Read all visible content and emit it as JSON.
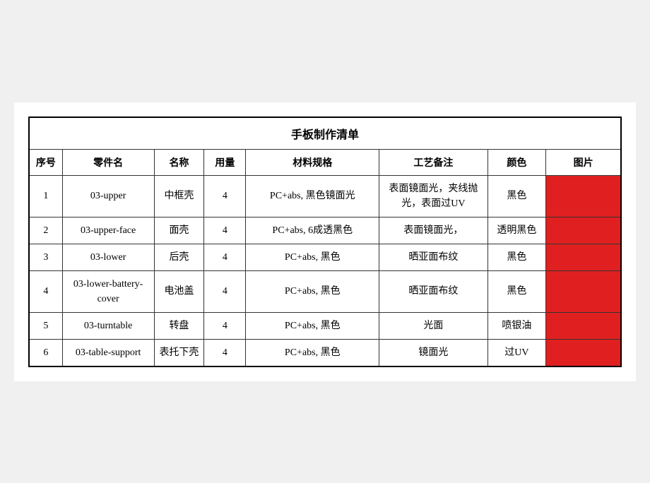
{
  "title": "手板制作清单",
  "headers": [
    "序号",
    "零件名",
    "名称",
    "用量",
    "材料规格",
    "工艺备注",
    "颜色",
    "图片"
  ],
  "rows": [
    {
      "seq": "1",
      "part": "03-upper",
      "name": "中框壳",
      "qty": "4",
      "spec": "PC+abs, 黑色镜面光",
      "process": "表面镜面光，夹线抛光，表面过UV",
      "color": "黑色"
    },
    {
      "seq": "2",
      "part": "03-upper-face",
      "name": "面壳",
      "qty": "4",
      "spec": "PC+abs, 6成透黑色",
      "process": "表面镜面光，",
      "color": "透明黑色"
    },
    {
      "seq": "3",
      "part": "03-lower",
      "name": "后壳",
      "qty": "4",
      "spec": "PC+abs, 黑色",
      "process": "晒亚面布纹",
      "color": "黑色"
    },
    {
      "seq": "4",
      "part": "03-lower-battery-cover",
      "name": "电池盖",
      "qty": "4",
      "spec": "PC+abs, 黑色",
      "process": "晒亚面布纹",
      "color": "黑色"
    },
    {
      "seq": "5",
      "part": "03-turntable",
      "name": "转盘",
      "qty": "4",
      "spec": "PC+abs, 黑色",
      "process": "光面",
      "color": "喷银油"
    },
    {
      "seq": "6",
      "part": "03-table-support",
      "name": "表托下壳",
      "qty": "4",
      "spec": "PC+abs, 黑色",
      "process": "镜面光",
      "color": "过UV"
    }
  ]
}
